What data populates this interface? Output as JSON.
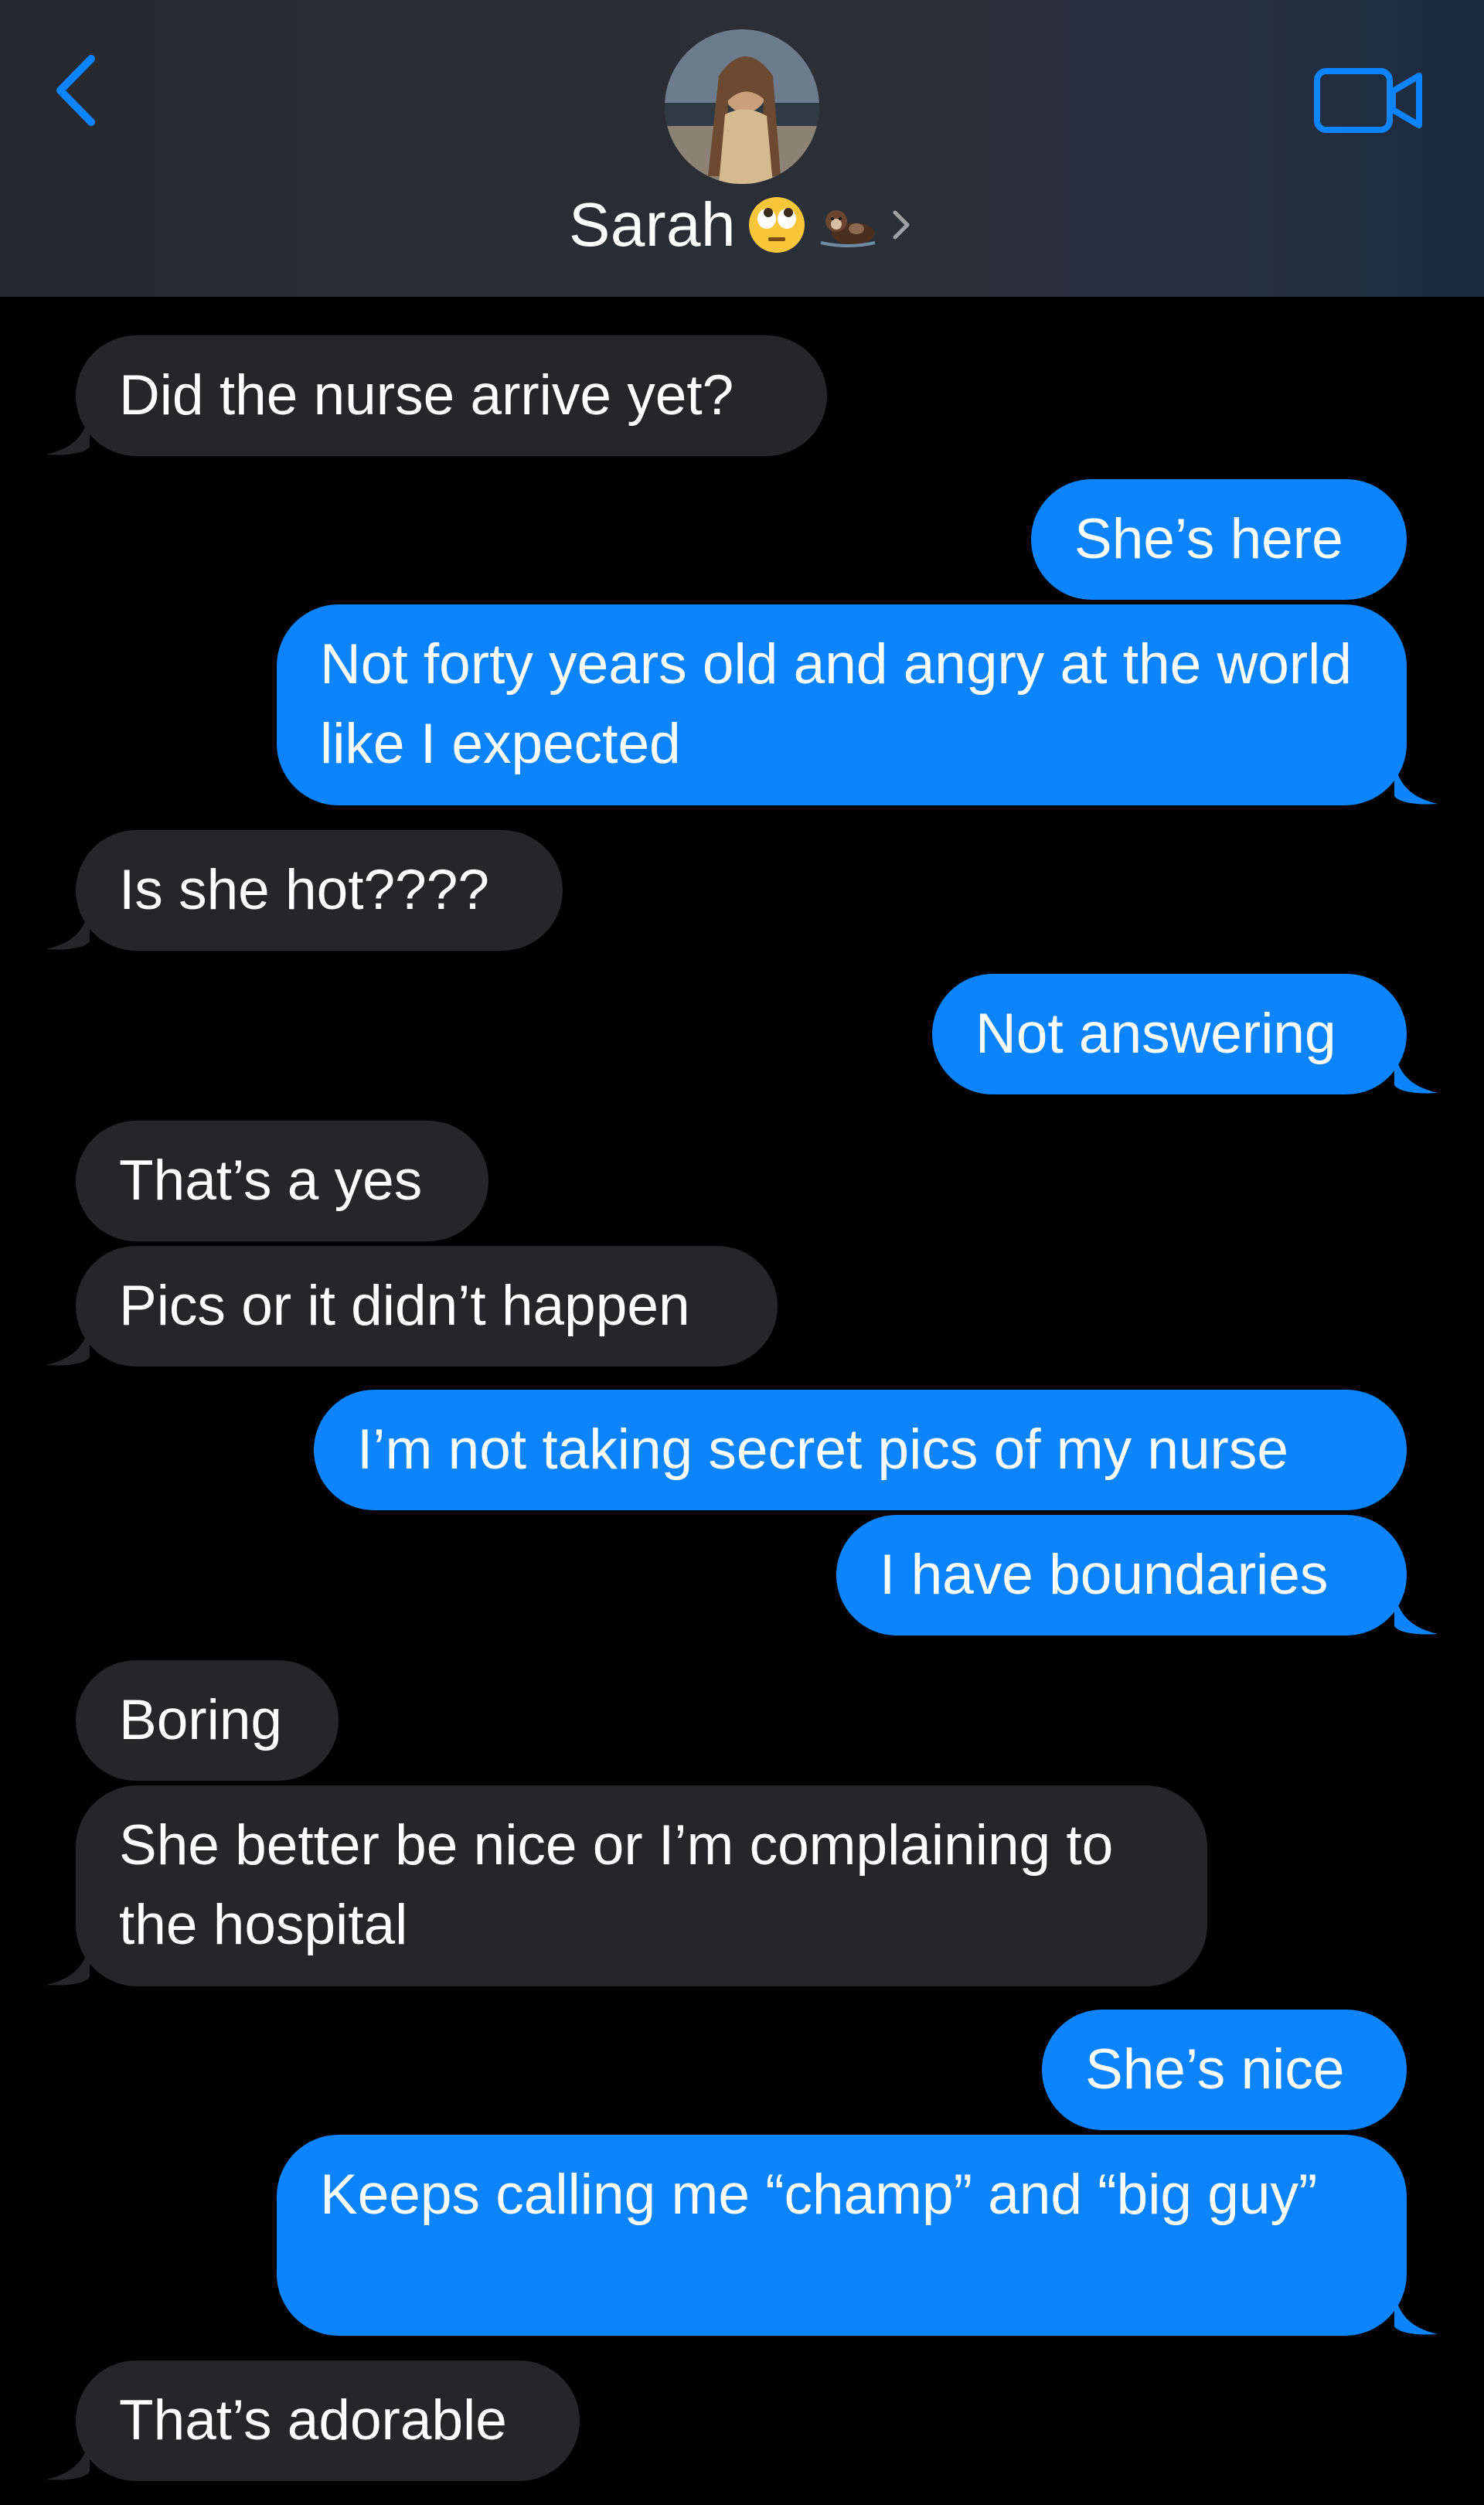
{
  "header": {
    "contact_name": "Sarah",
    "name_emojis": [
      "face-with-rolling-eyes",
      "otter"
    ],
    "accent_color": "#0b84fe"
  },
  "colors": {
    "incoming_bubble": "#262628",
    "outgoing_bubble": "#0b84fe",
    "background": "#000000"
  },
  "messages": [
    {
      "dir": "in",
      "text": "Did the nurse arrive yet?"
    },
    {
      "dir": "out",
      "text": "She’s here"
    },
    {
      "dir": "out",
      "text": "Not forty years old and angry at the world like I expected"
    },
    {
      "dir": "in",
      "text": "Is she hot????"
    },
    {
      "dir": "out",
      "text": "Not answering"
    },
    {
      "dir": "in",
      "text": "That’s a yes"
    },
    {
      "dir": "in",
      "text": "Pics or it didn’t happen"
    },
    {
      "dir": "out",
      "text": "I’m not taking secret pics of my nurse"
    },
    {
      "dir": "out",
      "text": "I have boundaries"
    },
    {
      "dir": "in",
      "text": "Boring"
    },
    {
      "dir": "in",
      "text": "She better be nice or I’m complaining to the hospital"
    },
    {
      "dir": "out",
      "text": "She’s nice"
    },
    {
      "dir": "out",
      "text": "Keeps calling me “champ” and “big guy”"
    },
    {
      "dir": "in",
      "text": "That’s adorable"
    }
  ]
}
